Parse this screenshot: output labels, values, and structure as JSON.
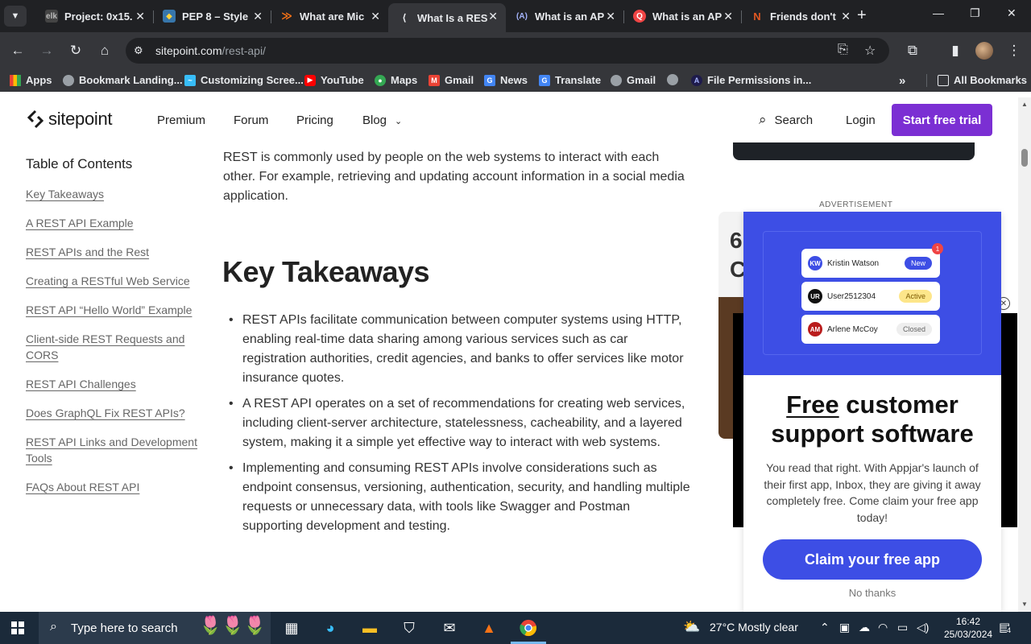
{
  "browser": {
    "tabs": [
      {
        "title": "Project: 0x15.",
        "favicon": "project-favicon",
        "color": "#444"
      },
      {
        "title": "PEP 8 – Style",
        "favicon": "python-favicon",
        "color": "#3776ab"
      },
      {
        "title": "What are Mic",
        "favicon": "orange-favicon",
        "color": "#f97316"
      },
      {
        "title": "What Is a RES",
        "favicon": "sitepoint-favicon",
        "color": "#35363a",
        "active": true
      },
      {
        "title": "What is an AP",
        "favicon": "a-favicon",
        "color": "#6366f1"
      },
      {
        "title": "What is an AP",
        "favicon": "red-favicon",
        "color": "#ef4444"
      },
      {
        "title": "Friends don't",
        "favicon": "n-favicon",
        "color": "#e25822"
      }
    ],
    "url_domain": "sitepoint.com",
    "url_path": "/rest-api/",
    "bookmarks": [
      {
        "label": "Apps",
        "icon": "apps-grid-icon"
      },
      {
        "label": "Bookmark Landing...",
        "icon": "globe-icon"
      },
      {
        "label": "Customizing Scree...",
        "icon": "tailwind-icon"
      },
      {
        "label": "YouTube",
        "icon": "youtube-icon"
      },
      {
        "label": "Maps",
        "icon": "maps-icon"
      },
      {
        "label": "Gmail",
        "icon": "gmail-icon"
      },
      {
        "label": "News",
        "icon": "news-icon"
      },
      {
        "label": "Translate",
        "icon": "translate-icon"
      },
      {
        "label": "Gmail",
        "icon": "globe-icon"
      },
      {
        "label": "",
        "icon": "globe-icon"
      },
      {
        "label": "File Permissions in...",
        "icon": "a-icon"
      }
    ],
    "all_bookmarks": "All Bookmarks"
  },
  "site": {
    "logo_text": "sitepoint",
    "nav": [
      "Premium",
      "Forum",
      "Pricing",
      "Blog"
    ],
    "search_label": "Search",
    "login_label": "Login",
    "cta_label": "Start free trial",
    "accent": "#7b2fd3"
  },
  "toc": {
    "title": "Table of Contents",
    "items": [
      "Key Takeaways",
      "A REST API Example",
      "REST APIs and the Rest",
      "Creating a RESTful Web Service",
      "REST API “Hello World” Example",
      "Client-side REST Requests and CORS",
      "REST API Challenges",
      "Does GraphQL Fix REST APIs?",
      "REST API Links and Development Tools",
      "FAQs About REST API"
    ]
  },
  "article": {
    "intro": "REST is commonly used by people on the web systems to interact with each other. For example, retrieving and updating account information in a social media application.",
    "heading": "Key Takeaways",
    "bullets": [
      "REST APIs facilitate communication between computer systems using HTTP, enabling real-time data sharing among various services such as car registration authorities, credit agencies, and banks to offer services like motor insurance quotes.",
      "A REST API operates on a set of recommendations for creating web services, including client-server architecture, statelessness, cacheability, and a layered system, making it a simple yet effective way to interact with web systems.",
      "Implementing and consuming REST APIs involve considerations such as endpoint consensus, versioning, authentication, security, and handling multiple requests or unnecessary data, with tools like Swagger and Postman supporting development and testing."
    ]
  },
  "sidebar_card": {
    "partial_line_1": "6",
    "partial_line_2": "C"
  },
  "ad": {
    "label": "ADVERTISEMENT",
    "notif_count": "1",
    "chips": [
      {
        "initials": "KW",
        "name": "Kristin Watson",
        "status": "New",
        "avatar_color": "#3d4ee5",
        "status_bg": "#3d4ee5",
        "status_fg": "#ffffff"
      },
      {
        "initials": "UR",
        "name": "User2512304",
        "status": "Active",
        "avatar_color": "#111111",
        "status_bg": "#fde68a",
        "status_fg": "#7c5a00"
      },
      {
        "initials": "AM",
        "name": "Arlene McCoy",
        "status": "Closed",
        "avatar_color": "#b91c1c",
        "status_bg": "#eeeeee",
        "status_fg": "#666666"
      }
    ],
    "title_underlined": "Free",
    "title_rest": " customer support software",
    "description": "You read that right. With Appjar's launch of their first app, Inbox, they are giving it away completely free. Come claim your free app today!",
    "cta": "Claim your free app",
    "dismiss": "No thanks",
    "brand_color": "#3d4ee5"
  },
  "taskbar": {
    "search_placeholder": "Type here to search",
    "weather": "27°C  Mostly clear",
    "time": "16:42",
    "date": "25/03/2024",
    "notification_count": "4"
  }
}
